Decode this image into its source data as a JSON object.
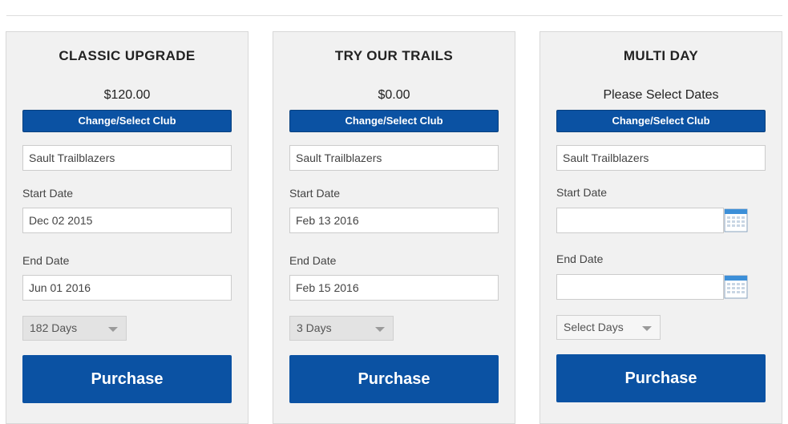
{
  "cards": [
    {
      "title": "CLASSIC UPGRADE",
      "price": "$120.00",
      "club_button": "Change/Select Club",
      "club_value": "Sault Trailblazers",
      "start_label": "Start Date",
      "start_value": "Dec 02 2015",
      "end_label": "End Date",
      "end_value": "Jun 01 2016",
      "days_value": "182 Days",
      "purchase_label": "Purchase"
    },
    {
      "title": "TRY OUR TRAILS",
      "price": "$0.00",
      "club_button": "Change/Select Club",
      "club_value": "Sault Trailblazers",
      "start_label": "Start Date",
      "start_value": "Feb 13 2016",
      "end_label": "End Date",
      "end_value": "Feb 15 2016",
      "days_value": "3 Days",
      "purchase_label": "Purchase"
    },
    {
      "title": "MULTI DAY",
      "price": "Please Select Dates",
      "club_button": "Change/Select Club",
      "club_value": "Sault Trailblazers",
      "start_label": "Start Date",
      "start_value": "",
      "end_label": "End Date",
      "end_value": "",
      "days_value": "Select Days",
      "purchase_label": "Purchase"
    }
  ],
  "colors": {
    "brand_blue": "#0b52a3",
    "card_bg": "#f1f1f1"
  },
  "icons": {
    "calendar": "calendar-icon",
    "dropdown": "chevron-down-icon"
  }
}
